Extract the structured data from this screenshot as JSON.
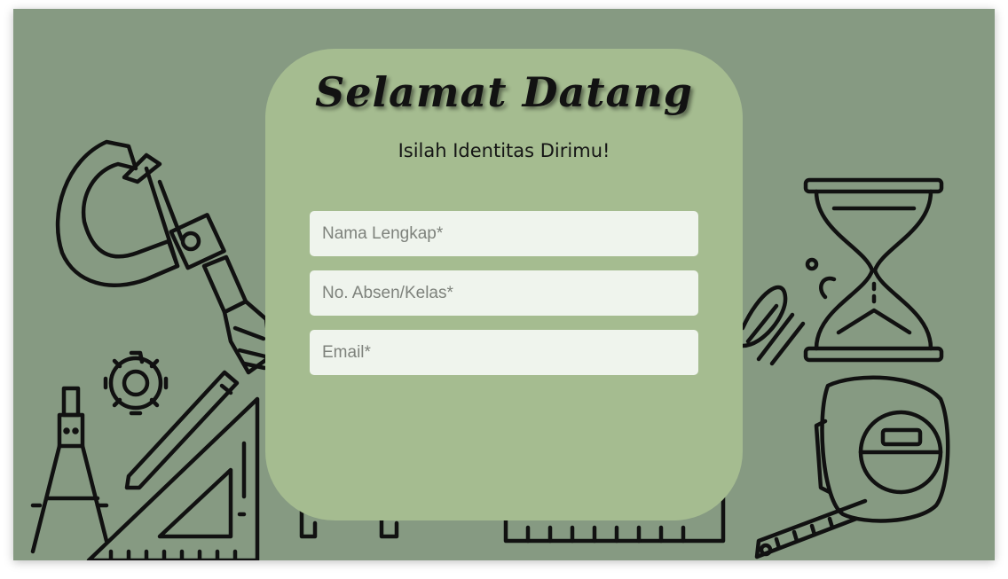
{
  "header": {
    "title": "Selamat Datang",
    "subtitle": "Isilah Identitas Dirimu!"
  },
  "form": {
    "fields": [
      {
        "placeholder": "Nama Lengkap*",
        "value": ""
      },
      {
        "placeholder": "No. Absen/Kelas*",
        "value": ""
      },
      {
        "placeholder": "Email*",
        "value": ""
      }
    ]
  },
  "colors": {
    "background": "#869a82",
    "card": "#a5bc90",
    "input": "#eff4ed",
    "ink": "#121212"
  },
  "decorations": [
    "micrometer-icon",
    "gear-icon",
    "drafting-compass-icon",
    "set-square-icon",
    "pencil-icon",
    "hourglass-icon",
    "tape-measure-icon",
    "celsius-icon",
    "ruler-icon"
  ]
}
